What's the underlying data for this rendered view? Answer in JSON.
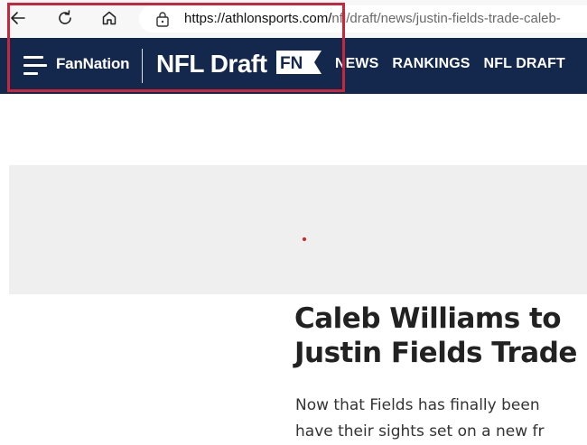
{
  "browser": {
    "url_host": "https://athlonsports.com/",
    "url_path": "nfl/draft/news/justin-fields-trade-caleb-"
  },
  "site": {
    "brand": "FanNation",
    "section": "NFL Draft",
    "logo_text": "FN",
    "nav": [
      "NEWS",
      "RANKINGS",
      "NFL DRAFT"
    ]
  },
  "article": {
    "headline_lines": [
      "Caleb Williams to",
      "Justin Fields Trade"
    ],
    "dek_lines": [
      "Now that Fields has finally been",
      "have their sights set on a new fr"
    ]
  },
  "colors": {
    "header_bg": "#14284e",
    "highlight": "#c8263a"
  }
}
